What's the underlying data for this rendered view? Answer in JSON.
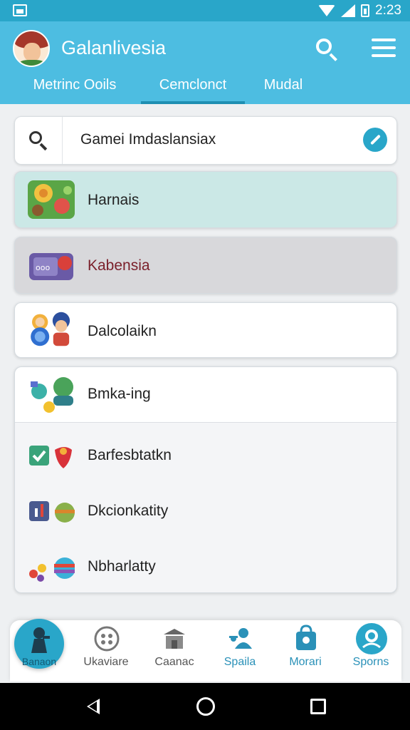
{
  "status_bar": {
    "time": "2:23"
  },
  "app_bar": {
    "title": "Galanlivesia",
    "tabs": [
      {
        "label": "Metrinc Ooils",
        "active": false
      },
      {
        "label": "Cemclonct",
        "active": true
      },
      {
        "label": "Mudal",
        "active": false
      }
    ]
  },
  "search": {
    "query": "Gamei Imdaslansiax"
  },
  "cards": [
    {
      "label": "Harnais",
      "background": "#cbe8e6"
    },
    {
      "label": "Kabensia",
      "background": "#d8d8db",
      "label_color": "#7a1f2a"
    },
    {
      "label": "Dalcolaikn",
      "background": "#ffffff"
    }
  ],
  "list": {
    "items": [
      {
        "label": "Bmka-ing"
      },
      {
        "label": "Barfesbtatkn"
      },
      {
        "label": "Dkcionkatity"
      },
      {
        "label": "Nbharlatty"
      }
    ]
  },
  "fab": {
    "label": "Banaon"
  },
  "bottom_nav": [
    {
      "label": "Ukaviare"
    },
    {
      "label": "Caanac"
    },
    {
      "label": "Spaila"
    },
    {
      "label": "Morari"
    },
    {
      "label": "Sporns"
    }
  ],
  "colors": {
    "primary": "#4dbde1",
    "status_bar": "#29a6c9",
    "accent": "#29a6c9"
  }
}
